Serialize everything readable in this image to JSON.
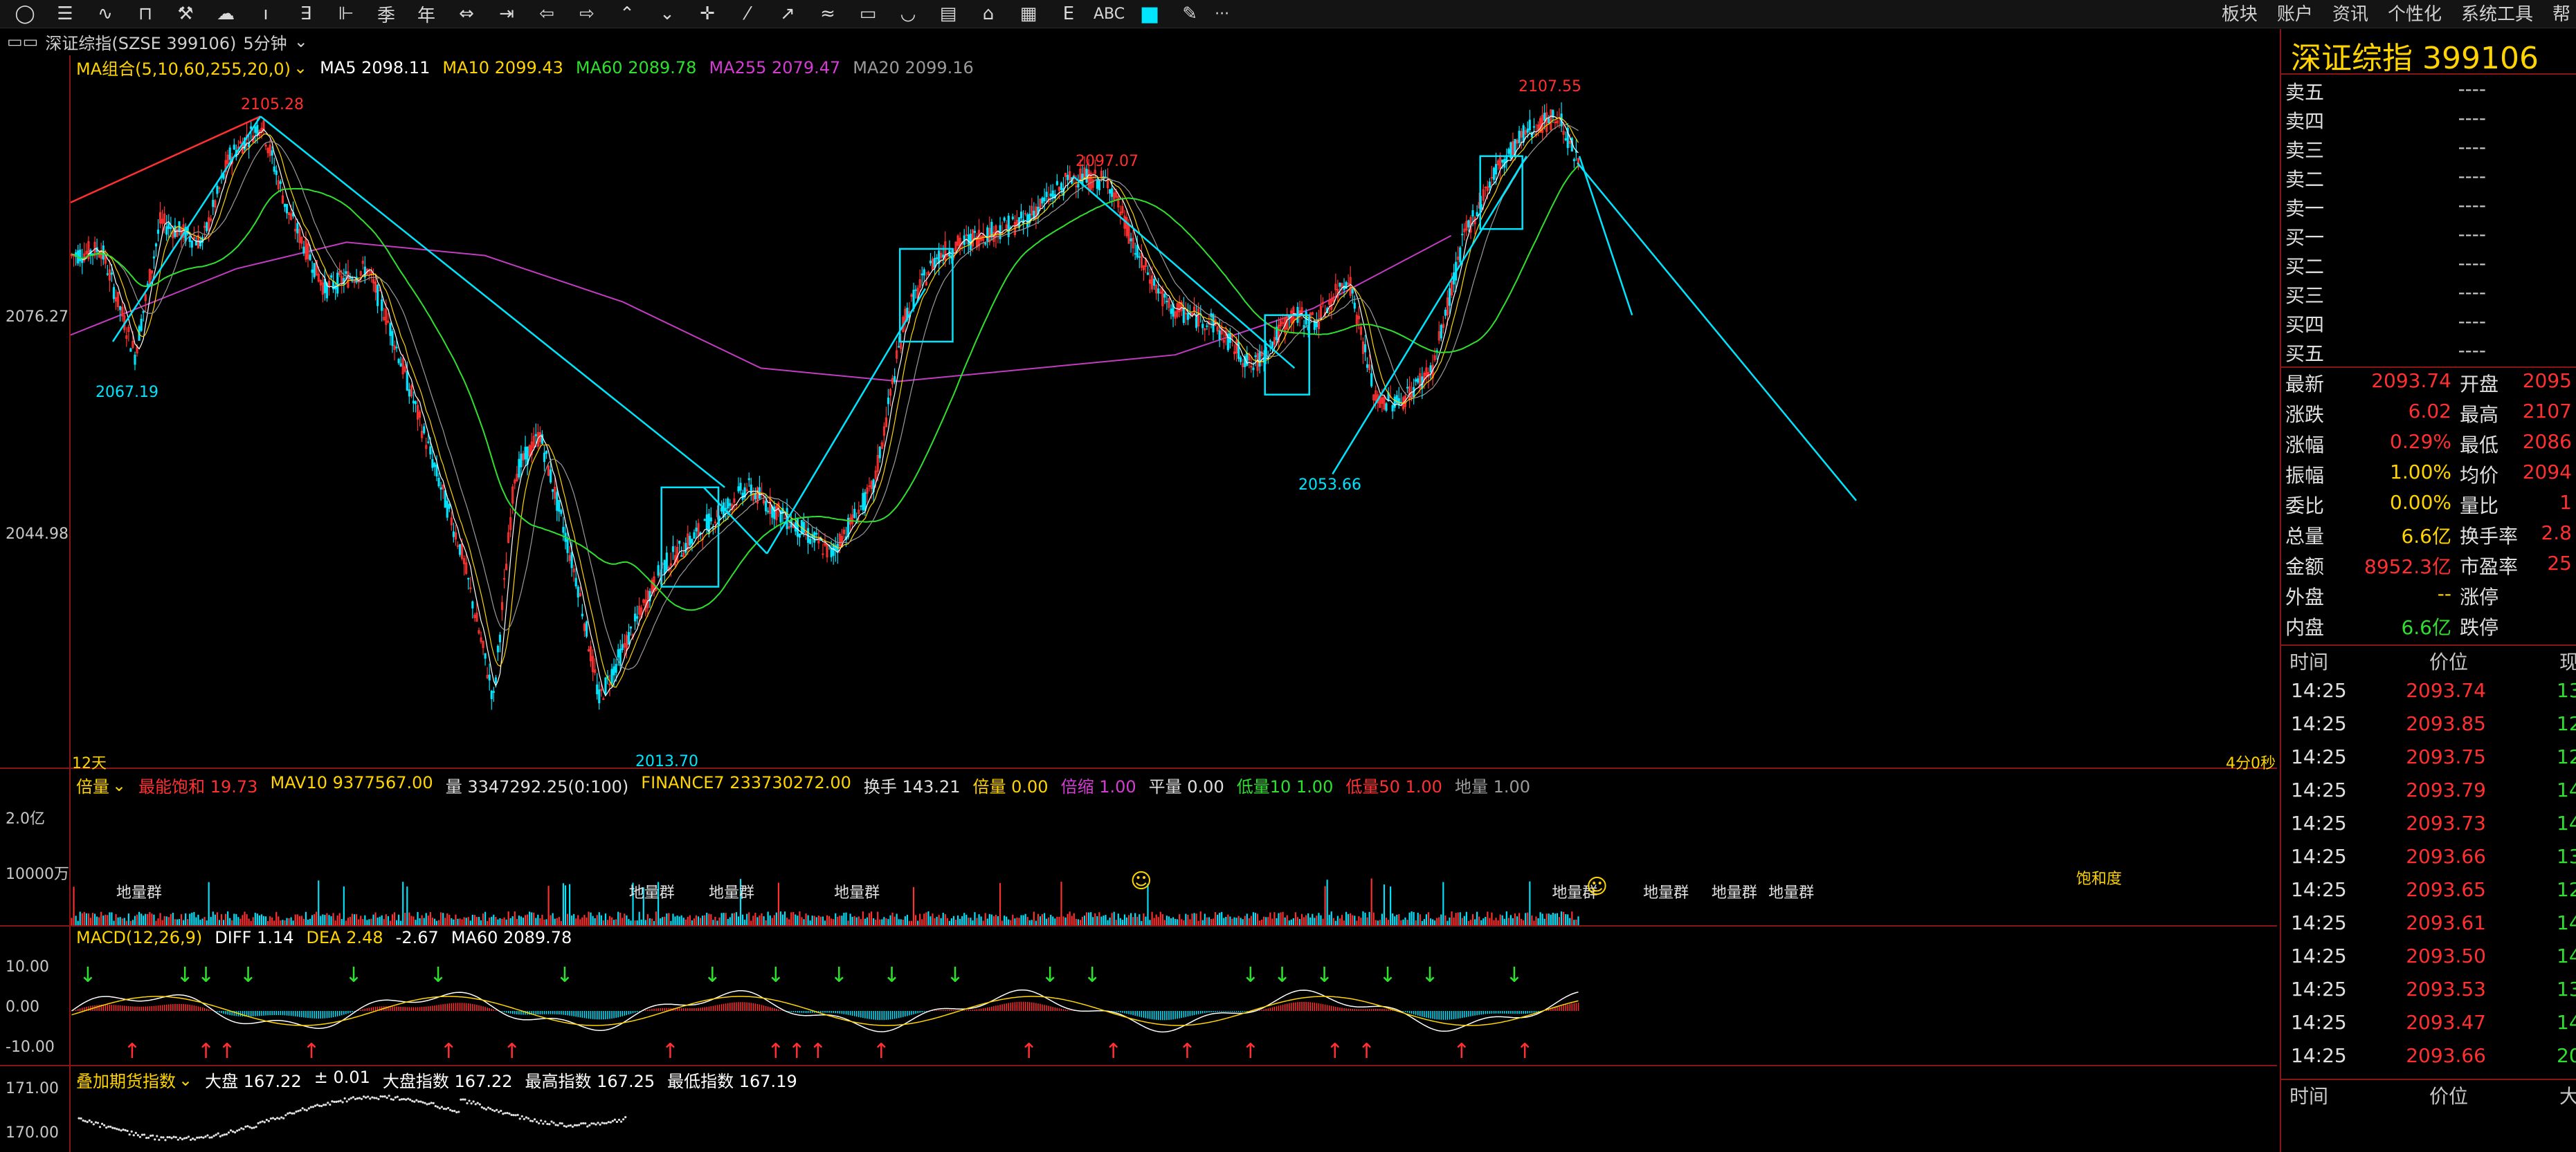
{
  "toolbar": {
    "icons": [
      "circle-icon",
      "list-icon",
      "line-chart-icon",
      "candle-icon",
      "tools-icon",
      "cloud-icon",
      "tick-icon",
      "step-icon",
      "bar-icon",
      "season-icon",
      "year-icon",
      "arrow-lr-icon",
      "arrow-jump-icon",
      "arrow-left-icon",
      "arrow-right-icon",
      "arrow-up-icon",
      "arrow-down-icon",
      "crosshair-icon",
      "line-icon",
      "segment-icon",
      "wave-icon",
      "rect-icon",
      "arc-icon",
      "ruler-icon",
      "home-icon",
      "grid-icon",
      "text-e-icon"
    ],
    "abc": "ABC",
    "more": "···"
  },
  "topmenu": [
    "板块",
    "账户",
    "资讯",
    "个性化",
    "系统工具",
    "帮"
  ],
  "security": {
    "name": "深证综指(SZSE 399106)",
    "period": "5分钟"
  },
  "ma_legend": {
    "group": "MA组合(5,10,60,255,20,0)",
    "items": [
      {
        "text": "MA5 2098.11",
        "color": "#ffffff"
      },
      {
        "text": "MA10 2099.43",
        "color": "#ffd400"
      },
      {
        "text": "MA60 2089.78",
        "color": "#2fe02f"
      },
      {
        "text": "MA255 2079.47",
        "color": "#d43cd4"
      },
      {
        "text": "MA20 2099.16",
        "color": "#9a9a9a"
      }
    ]
  },
  "price_axis": {
    "labels": [
      "2076.27",
      "2044.98"
    ]
  },
  "annotations": {
    "high1": "2105.28",
    "low1": "2067.19",
    "high2": "2097.07",
    "low2": "2013.70",
    "low3": "2053.66",
    "high3": "2107.55",
    "days": "12天",
    "countdown": "4分0秒"
  },
  "vol_legend": {
    "title": "倍量",
    "items": [
      {
        "text": "最能饱和 19.73",
        "color": "#ff3030"
      },
      {
        "text": "MAV10 9377567.00",
        "color": "#ffd400"
      },
      {
        "text": "量 3347292.25(0:100)",
        "color": "#e0e0e0"
      },
      {
        "text": "FINANCE7 233730272.00",
        "color": "#ffd400"
      },
      {
        "text": "换手 143.21",
        "color": "#e0e0e0"
      },
      {
        "text": "倍量 0.00",
        "color": "#ffd400"
      },
      {
        "text": "倍缩 1.00",
        "color": "#d43cd4"
      },
      {
        "text": "平量 0.00",
        "color": "#e0e0e0"
      },
      {
        "text": "低量10 1.00",
        "color": "#2fe02f"
      },
      {
        "text": "低量50 1.00",
        "color": "#ff3030"
      },
      {
        "text": "地量 1.00",
        "color": "#9a9a9a"
      }
    ],
    "axis": [
      "2.0亿",
      "10000万"
    ],
    "tags": [
      "地量群",
      "地量群",
      "地量群",
      "地量群",
      "地量群",
      "地量群",
      "地量群",
      "地量群",
      "饱和度"
    ]
  },
  "macd_legend": {
    "title": "MACD(12,26,9)",
    "items": [
      {
        "text": "DIFF 1.14",
        "color": "#ffffff"
      },
      {
        "text": "DEA 2.48",
        "color": "#ffd400"
      },
      {
        "text": "-2.67",
        "color": "#ffffff"
      },
      {
        "text": "MA60 2089.78",
        "color": "#ffffff"
      }
    ],
    "axis": [
      "10.00",
      "0.00",
      "-10.00"
    ]
  },
  "fut_legend": {
    "title": "叠加期货指数",
    "items": [
      {
        "text": "大盘 167.22",
        "color": "#ffffff"
      },
      {
        "text": "± 0.01",
        "color": "#ffffff"
      },
      {
        "text": "大盘指数 167.22",
        "color": "#ffffff"
      },
      {
        "text": "最高指数 167.25",
        "color": "#ffffff"
      },
      {
        "text": "最低指数 167.19",
        "color": "#ffffff"
      }
    ],
    "axis": [
      "171.00",
      "170.00"
    ]
  },
  "quote": {
    "title": "深证综指  399106",
    "asks": [
      {
        "label": "卖五",
        "value": "----"
      },
      {
        "label": "卖四",
        "value": "----"
      },
      {
        "label": "卖三",
        "value": "----"
      },
      {
        "label": "卖二",
        "value": "----"
      },
      {
        "label": "卖一",
        "value": "----"
      }
    ],
    "bids": [
      {
        "label": "买一",
        "value": "----"
      },
      {
        "label": "买二",
        "value": "----"
      },
      {
        "label": "买三",
        "value": "----"
      },
      {
        "label": "买四",
        "value": "----"
      },
      {
        "label": "买五",
        "value": "----"
      }
    ],
    "stats": [
      {
        "l1": "最新",
        "v1": "2093.74",
        "c1": "#ff3030",
        "l2": "开盘",
        "v2": "2095"
      },
      {
        "l1": "涨跌",
        "v1": "6.02",
        "c1": "#ff3030",
        "l2": "最高",
        "v2": "2107"
      },
      {
        "l1": "涨幅",
        "v1": "0.29%",
        "c1": "#ff3030",
        "l2": "最低",
        "v2": "2086"
      },
      {
        "l1": "振幅",
        "v1": "1.00%",
        "c1": "#ffd400",
        "l2": "均价",
        "v2": "2094"
      },
      {
        "l1": "委比",
        "v1": "0.00%",
        "c1": "#ffd400",
        "l2": "量比",
        "v2": "1"
      },
      {
        "l1": "总量",
        "v1": "6.6亿",
        "c1": "#ffd400",
        "l2": "换手率",
        "v2": "2.8"
      },
      {
        "l1": "金额",
        "v1": "8952.3亿",
        "c1": "#ff3030",
        "l2": "市盈率",
        "v2": "25"
      },
      {
        "l1": "外盘",
        "v1": "--",
        "c1": "#ffd400",
        "l2": "涨停",
        "v2": ""
      },
      {
        "l1": "内盘",
        "v1": "6.6亿",
        "c1": "#2fe02f",
        "l2": "跌停",
        "v2": ""
      }
    ],
    "tick_header": {
      "time": "时间",
      "price": "价位",
      "now": "现"
    },
    "ticks": [
      {
        "time": "14:25",
        "price": "2093.74",
        "vol": "13"
      },
      {
        "time": "14:25",
        "price": "2093.85",
        "vol": "12"
      },
      {
        "time": "14:25",
        "price": "2093.75",
        "vol": "12"
      },
      {
        "time": "14:25",
        "price": "2093.79",
        "vol": "14"
      },
      {
        "time": "14:25",
        "price": "2093.73",
        "vol": "14"
      },
      {
        "time": "14:25",
        "price": "2093.66",
        "vol": "13"
      },
      {
        "time": "14:25",
        "price": "2093.65",
        "vol": "12"
      },
      {
        "time": "14:25",
        "price": "2093.61",
        "vol": "14"
      },
      {
        "time": "14:25",
        "price": "2093.50",
        "vol": "14"
      },
      {
        "time": "14:25",
        "price": "2093.53",
        "vol": "13"
      },
      {
        "time": "14:25",
        "price": "2093.47",
        "vol": "14"
      },
      {
        "time": "14:25",
        "price": "2093.66",
        "vol": "20"
      }
    ],
    "tick_footer": {
      "time": "时间",
      "price": "价位",
      "big": "大"
    }
  },
  "colors": {
    "up": "#ff3030",
    "down": "#00e5ff",
    "grid": "#8b1414",
    "cyan": "#00e5ff"
  }
}
